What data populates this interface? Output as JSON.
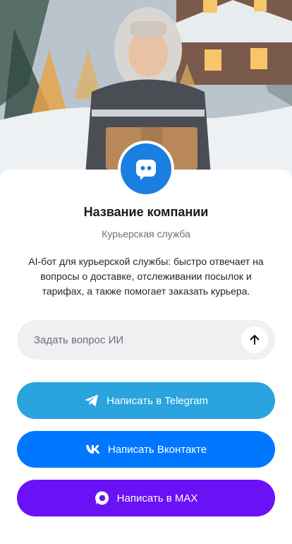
{
  "company": {
    "name": "Название компании",
    "category": "Курьерская служба",
    "description": "AI-бот для курьерской службы: быстро отвечает на вопросы о доставке, отслеживании посылок и тарифах, а также помогает заказать курьера."
  },
  "ask": {
    "placeholder": "Задать вопрос ИИ",
    "send_icon": "arrow-up-icon"
  },
  "buttons": {
    "telegram": {
      "label": "Написать в Telegram",
      "icon": "telegram-icon",
      "color": "#2aa3de"
    },
    "vk": {
      "label": "Написать Вконтакте",
      "icon": "vk-icon",
      "color": "#0077ff"
    },
    "max": {
      "label": "Написать в MAX",
      "icon": "max-icon",
      "color": "#6a11f5"
    }
  },
  "colors": {
    "logo": "#1a7fe0",
    "text": "#1b1b1f",
    "muted": "#6b6f76",
    "input_bg": "#eff0f2"
  }
}
